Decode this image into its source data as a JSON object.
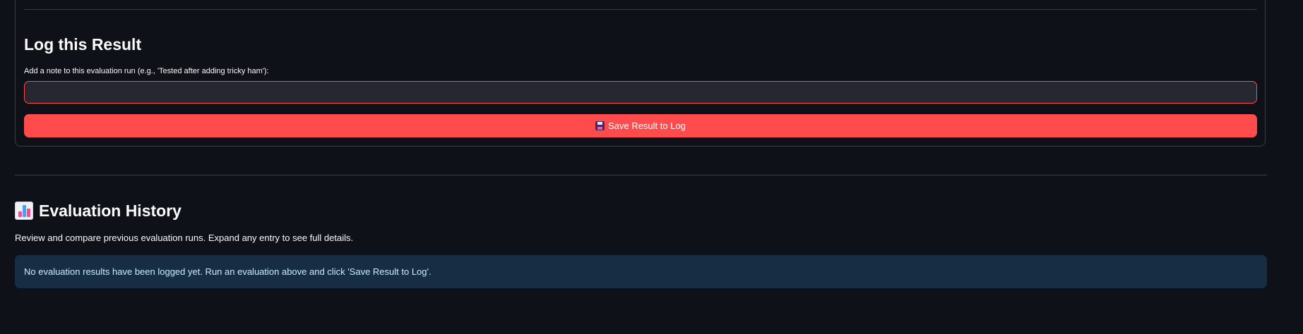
{
  "log_section": {
    "title": "Log this Result",
    "note_label": "Add a note to this evaluation run (e.g., 'Tested after adding tricky ham'):",
    "note_value": "",
    "save_button_icon": "floppy-disk-icon",
    "save_button_label": "Save Result to Log"
  },
  "history_section": {
    "icon": "bar-chart-icon",
    "title": "Evaluation History",
    "description": "Review and compare previous evaluation runs. Expand any entry to see full details.",
    "info_message": "No evaluation results have been logged yet. Run an evaluation above and click 'Save Result to Log'."
  },
  "colors": {
    "background": "#0e1117",
    "primary": "#ff4b4b",
    "info_background": "#172d43",
    "info_text": "#c7ebff",
    "input_background": "#262730"
  }
}
